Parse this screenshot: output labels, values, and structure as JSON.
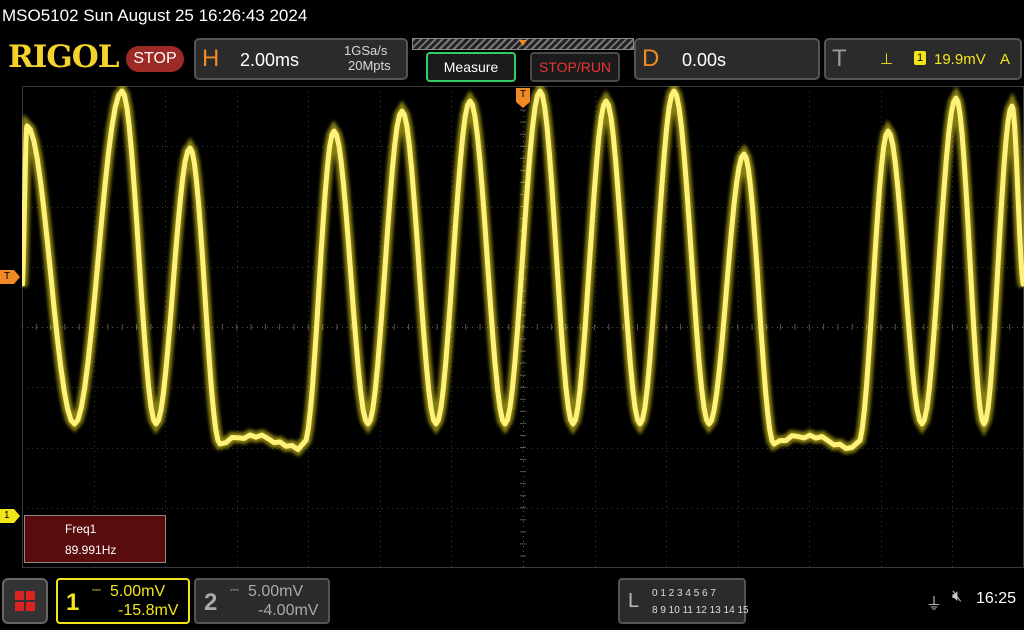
{
  "titlebar": {
    "text": "MSO5102  Sun August 25 16:26:43 2024"
  },
  "logo": "RIGOL",
  "run_state": "STOP",
  "horizontal": {
    "letter": "H",
    "timebase": "2.00ms",
    "sample_rate": "1GSa/s",
    "memory_depth": "20Mpts"
  },
  "buttons": {
    "measure": "Measure",
    "stop_run": "STOP/RUN"
  },
  "delay": {
    "letter": "D",
    "value": "0.00s"
  },
  "trigger": {
    "letter": "T",
    "source": "1",
    "level": "19.9mV",
    "mode": "A"
  },
  "markers": {
    "trigger_level": "T",
    "channel1": "1",
    "hpos": "T"
  },
  "measurement": {
    "name": "Freq1",
    "value": "89.991Hz"
  },
  "channel1": {
    "number": "1",
    "scale": "5.00mV",
    "offset": "-15.8mV"
  },
  "channel2": {
    "number": "2",
    "scale": "5.00mV",
    "offset": "-4.00mV"
  },
  "logic": {
    "letter": "L",
    "row1": "0 1 2 3  4 5 6 7",
    "row2": "8 9 10 11 12 13 14 15"
  },
  "status": {
    "time": "16:25",
    "usb_icon": "usb-icon",
    "speaker_icon": "speaker-muted-icon"
  },
  "colors": {
    "trace": "#f3e51c",
    "accent": "#f08a24",
    "stop": "#9e2a26"
  },
  "waveform": {
    "description_levels": "peaks high, troughs mid, periodic flat low segments",
    "frequency_hz": 89.991
  }
}
